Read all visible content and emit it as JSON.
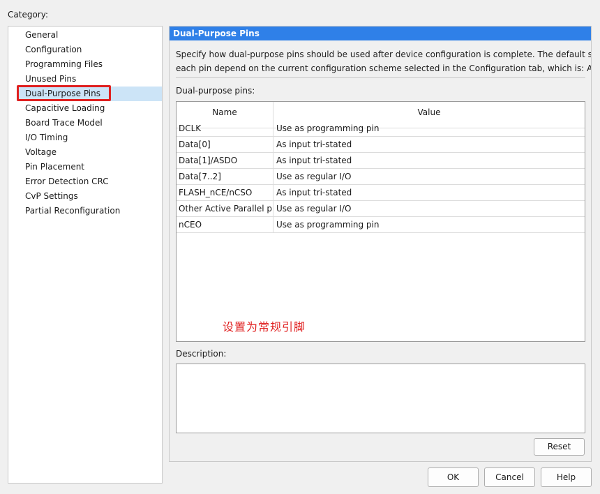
{
  "category": {
    "label": "Category:",
    "items": [
      {
        "label": "General",
        "selected": false
      },
      {
        "label": "Configuration",
        "selected": false
      },
      {
        "label": "Programming Files",
        "selected": false
      },
      {
        "label": "Unused Pins",
        "selected": false
      },
      {
        "label": "Dual-Purpose Pins",
        "selected": true
      },
      {
        "label": "Capacitive Loading",
        "selected": false
      },
      {
        "label": "Board Trace Model",
        "selected": false
      },
      {
        "label": "I/O Timing",
        "selected": false
      },
      {
        "label": "Voltage",
        "selected": false
      },
      {
        "label": "Pin Placement",
        "selected": false
      },
      {
        "label": "Error Detection CRC",
        "selected": false
      },
      {
        "label": "CvP Settings",
        "selected": false
      },
      {
        "label": "Partial Reconfiguration",
        "selected": false
      }
    ],
    "highlight_color": "#e02020",
    "selected_color": "#cce4f7"
  },
  "panel": {
    "title": "Dual-Purpose Pins",
    "header_color": "#2f80e8",
    "description_line1": "Specify how dual-purpose pins should be used after device configuration is complete. The default settings for",
    "description_line2": "each pin depend on the current configuration scheme selected in the Configuration tab, which is:  Active Serial",
    "pins_label": "Dual-purpose pins:",
    "table": {
      "headers": {
        "name": "Name",
        "value": "Value"
      },
      "rows": [
        {
          "name": "DCLK",
          "value": "Use as programming pin"
        },
        {
          "name": "Data[0]",
          "value": "As input tri-stated"
        },
        {
          "name": "Data[1]/ASDO",
          "value": "As input tri-stated"
        },
        {
          "name": "Data[7..2]",
          "value": "Use as regular I/O"
        },
        {
          "name": "FLASH_nCE/nCSO",
          "value": "As input tri-stated"
        },
        {
          "name": "Other Active Parallel pins",
          "value": "Use as regular I/O"
        },
        {
          "name": "nCEO",
          "value": "Use as programming pin"
        }
      ]
    },
    "annotation": "设置为常规引脚",
    "annotation_color": "#e02020",
    "description_label": "Description:",
    "description_value": "",
    "reset_label": "Reset"
  },
  "buttons": {
    "ok": "OK",
    "cancel": "Cancel",
    "help": "Help"
  }
}
